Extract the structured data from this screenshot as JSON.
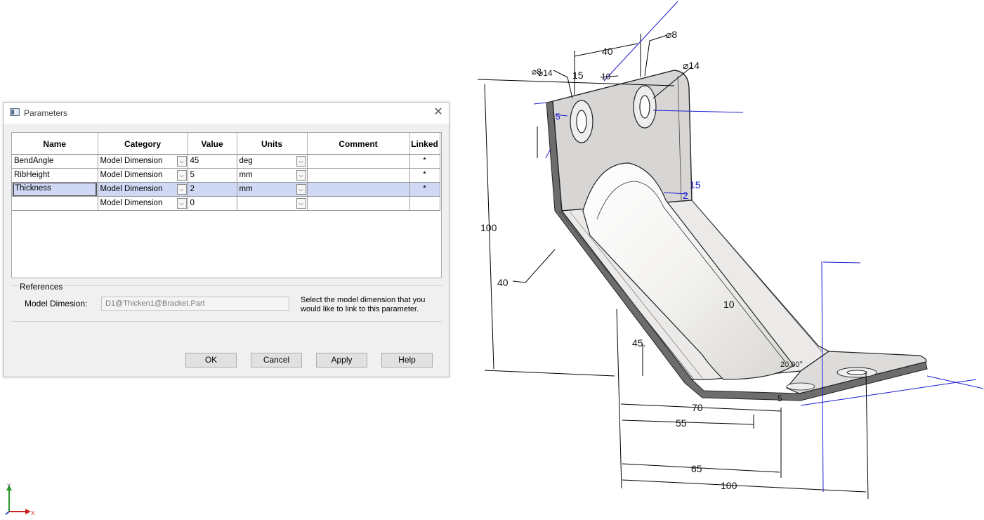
{
  "dialog": {
    "title": "Parameters",
    "close_glyph": "✕",
    "columns": [
      "Name",
      "Category",
      "Value",
      "Units",
      "Comment",
      "Linked"
    ],
    "rows": [
      {
        "name": "BendAngle",
        "category": "Model Dimension",
        "value": "45",
        "units": "deg",
        "comment": "",
        "linked": "*"
      },
      {
        "name": "RibHeight",
        "category": "Model Dimension",
        "value": "5",
        "units": "mm",
        "comment": "",
        "linked": "*"
      },
      {
        "name": "Thickness",
        "category": "Model Dimension",
        "value": "2",
        "units": "mm",
        "comment": "",
        "linked": "*"
      },
      {
        "name": "",
        "category": "Model Dimension",
        "value": "0",
        "units": "",
        "comment": "",
        "linked": ""
      }
    ],
    "selected_row": 2,
    "references": {
      "title": "References",
      "label": "Model Dimesion:",
      "value": "D1@Thicken1@Bracket.Part",
      "help": "Select the model dimension that you would like to link to this parameter."
    },
    "buttons": {
      "ok": "OK",
      "cancel": "Cancel",
      "apply": "Apply",
      "help": "Help"
    }
  },
  "viewport": {
    "dimensions": [
      "40",
      "⌀8",
      "⌀14",
      "⌀8",
      "⌀14",
      "15",
      "10",
      "5",
      "100",
      "40",
      "15",
      "2",
      "10",
      "45.",
      "20.00°",
      "70",
      "55",
      "5",
      "65",
      "100"
    ],
    "triad": {
      "y": "Y",
      "x": "X"
    }
  },
  "colors": {
    "dimension_blue": "#1a1ad0",
    "part_face": "#d8d6d4",
    "part_edge": "#222222"
  }
}
